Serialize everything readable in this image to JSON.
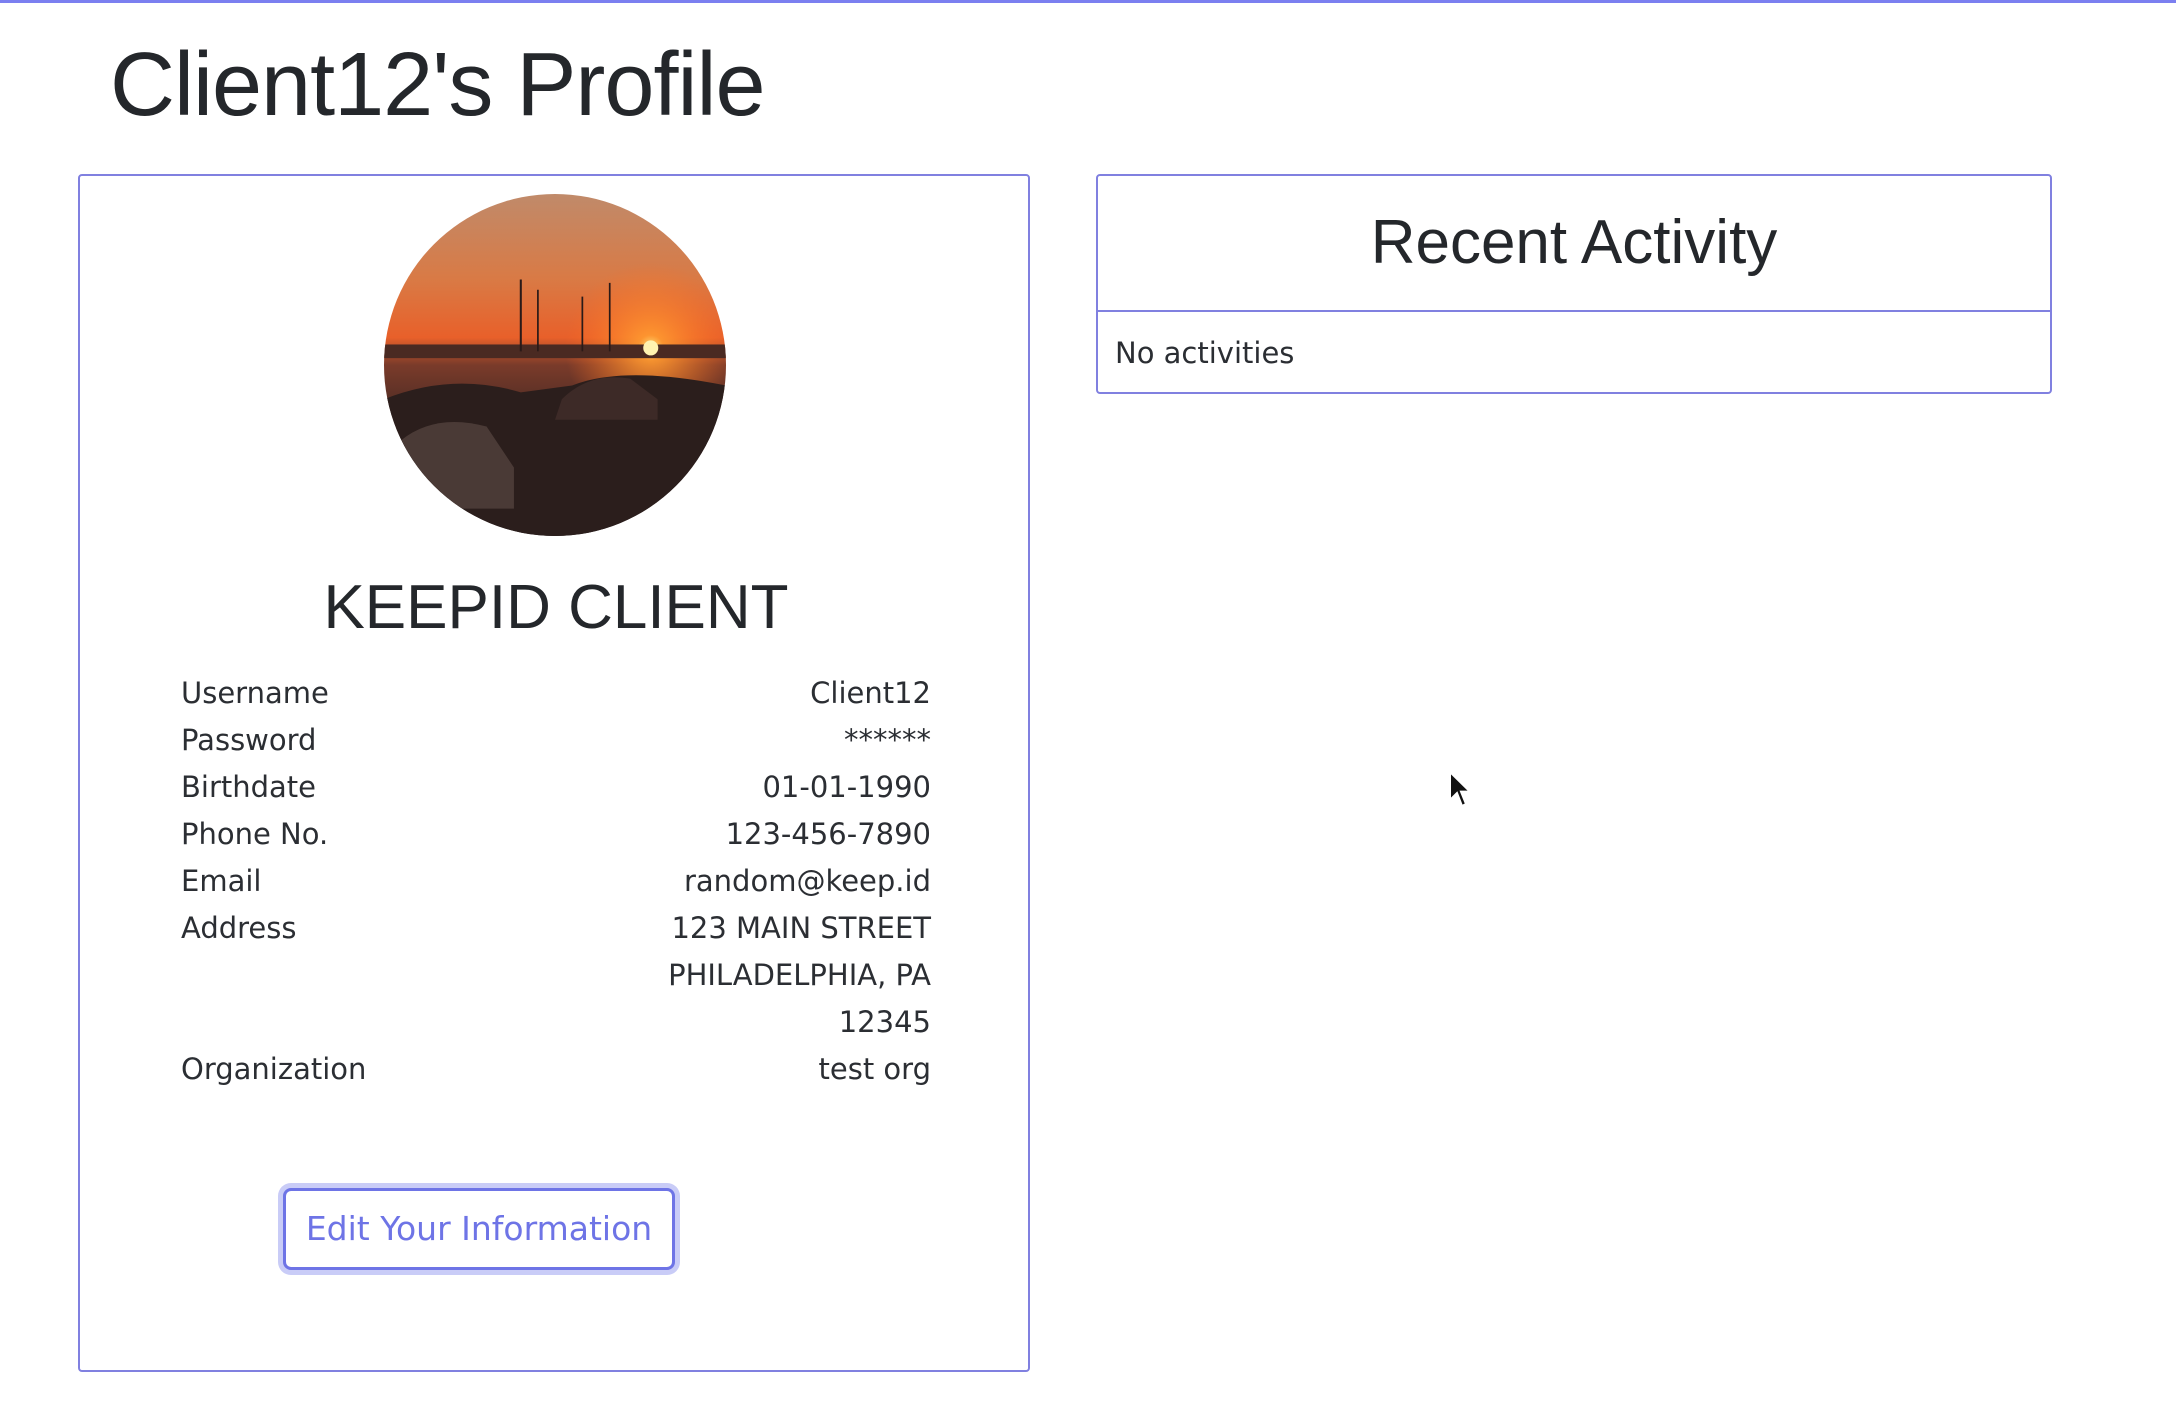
{
  "page": {
    "title": "Client12's Profile",
    "accent_color": "#7b7ff0"
  },
  "profile": {
    "avatar_icon": "profile-photo-sunset",
    "name": "KEEPID CLIENT",
    "fields": [
      {
        "label": "Username",
        "value": "Client12"
      },
      {
        "label": "Password",
        "value": "******"
      },
      {
        "label": "Birthdate",
        "value": "01-01-1990"
      },
      {
        "label": "Phone No.",
        "value": "123-456-7890"
      },
      {
        "label": "Email",
        "value": "random@keep.id"
      }
    ],
    "address": {
      "label": "Address",
      "lines": [
        "123 MAIN STREET",
        "PHILADELPHIA, PA",
        "12345"
      ]
    },
    "organization": {
      "label": "Organization",
      "value": "test org"
    },
    "edit_button_label": "Edit Your Information"
  },
  "activity": {
    "title": "Recent Activity",
    "empty_text": "No activities"
  }
}
